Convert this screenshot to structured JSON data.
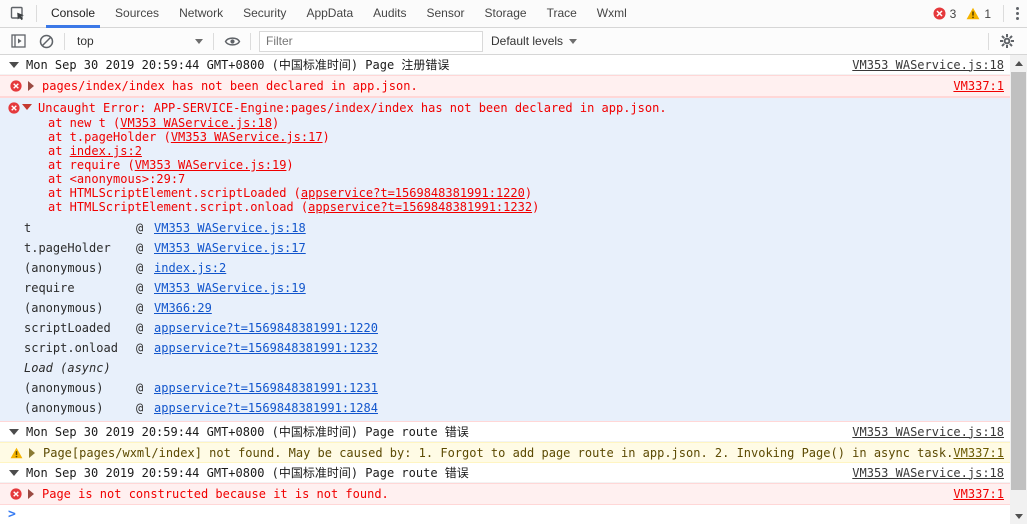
{
  "icons": {
    "inspect": "inspect-element-cursor",
    "sidebar_toggle": "show-console-sidebar",
    "clear": "clear-console-circle-slash",
    "eye": "live-expression-eye",
    "gear": "settings-gear",
    "error_badge": "red-circle-x",
    "warning_badge": "yellow-triangle-exclamation",
    "menu": "vertical-three-dots"
  },
  "tabbar": {
    "tabs": [
      {
        "label": "Console"
      },
      {
        "label": "Sources"
      },
      {
        "label": "Network"
      },
      {
        "label": "Security"
      },
      {
        "label": "AppData"
      },
      {
        "label": "Audits"
      },
      {
        "label": "Sensor"
      },
      {
        "label": "Storage"
      },
      {
        "label": "Trace"
      },
      {
        "label": "Wxml"
      }
    ],
    "error_count": "3",
    "warning_count": "1"
  },
  "toolbar": {
    "context": "top",
    "filter_placeholder": "Filter",
    "levels": "Default levels"
  },
  "colors": {
    "accent_blue": "#3b78e7",
    "error_red": "#f00000",
    "error_bg": "#fff0f0",
    "warning_bg": "#fffbe5",
    "selected_bg": "#e8f0fb",
    "link_blue": "#1155cc"
  },
  "console": {
    "at_sign": "@",
    "prompt": ">",
    "group1": {
      "time": "Mon Sep 30 2019 20:59:44 GMT+0800 (中国标准时间) Page 注册错误",
      "source": "VM353 WAService.js:18"
    },
    "error1": {
      "text": "pages/index/index has not been declared in app.json.",
      "source": "VM337:1"
    },
    "uncaught": {
      "message": "Uncaught Error: APP-SERVICE-Engine:pages/index/index has not been declared in app.json.",
      "frames": [
        {
          "pre": "at new t (",
          "link": "VM353 WAService.js:18",
          "post": ")"
        },
        {
          "pre": "at t.pageHolder (",
          "link": "VM353 WAService.js:17",
          "post": ")"
        },
        {
          "pre": "at ",
          "link": "index.js:2",
          "post": ""
        },
        {
          "pre": "at require (",
          "link": "VM353 WAService.js:19",
          "post": ")"
        },
        {
          "pre": "at <anonymous>:29:7",
          "link": "",
          "post": ""
        },
        {
          "pre": "at HTMLScriptElement.scriptLoaded (",
          "link": "appservice?t=1569848381991:1220",
          "post": ")"
        },
        {
          "pre": "at HTMLScriptElement.script.onload (",
          "link": "appservice?t=1569848381991:1232",
          "post": ")"
        }
      ],
      "stack": [
        {
          "fn": "t",
          "link": "VM353 WAService.js:18"
        },
        {
          "fn": "t.pageHolder",
          "link": "VM353 WAService.js:17"
        },
        {
          "fn": "(anonymous)",
          "link": "index.js:2"
        },
        {
          "fn": "require",
          "link": "VM353 WAService.js:19"
        },
        {
          "fn": "(anonymous)",
          "link": "VM366:29"
        },
        {
          "fn": "scriptLoaded",
          "link": "appservice?t=1569848381991:1220"
        },
        {
          "fn": "script.onload",
          "link": "appservice?t=1569848381991:1232"
        },
        {
          "fn": "Load (async)",
          "link": ""
        },
        {
          "fn": "(anonymous)",
          "link": "appservice?t=1569848381991:1231"
        },
        {
          "fn": "(anonymous)",
          "link": "appservice?t=1569848381991:1284"
        }
      ]
    },
    "group2": {
      "time": "Mon Sep 30 2019 20:59:44 GMT+0800 (中国标准时间) Page route 错误",
      "source": "VM353 WAService.js:18"
    },
    "warning1": {
      "text": "Page[pages/wxml/index] not found. May be caused by: 1. Forgot to add page route in app.json. 2. Invoking Page() in async task.",
      "source": "VM337:1"
    },
    "group3": {
      "time": "Mon Sep 30 2019 20:59:44 GMT+0800 (中国标准时间) Page route 错误",
      "source": "VM353 WAService.js:18"
    },
    "error2": {
      "text": "Page is not constructed because it is not found.",
      "source": "VM337:1"
    }
  }
}
